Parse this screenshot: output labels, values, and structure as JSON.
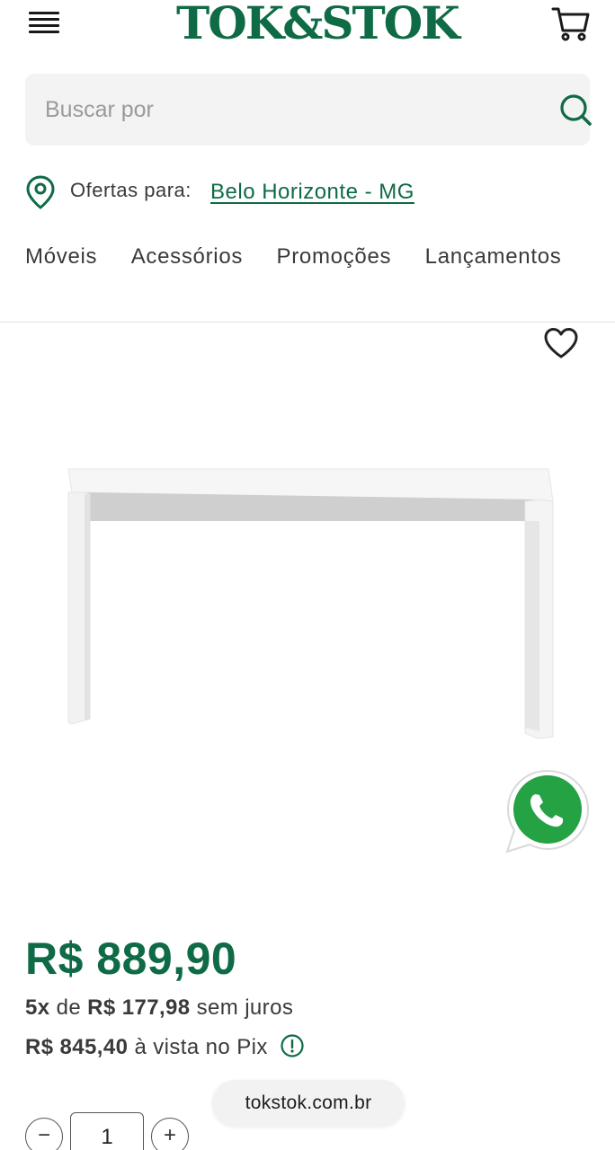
{
  "header": {
    "logo_text": "TOK&STOK",
    "menu_icon": "hamburger-menu-icon",
    "cart_icon": "shopping-cart-icon"
  },
  "search": {
    "placeholder": "Buscar por",
    "icon": "search-icon"
  },
  "location": {
    "prefix": "Ofertas para:",
    "city": "Belo Horizonte - MG",
    "icon": "map-pin-icon"
  },
  "nav": {
    "items": [
      "Móveis",
      "Acessórios",
      "Promoções",
      "Lançamentos"
    ]
  },
  "product": {
    "image_alt": "white-console-table",
    "favorite_icon": "heart-icon",
    "price": "R$ 889,90",
    "installments": {
      "count": "5x",
      "de": "de",
      "amount": "R$ 177,98",
      "suffix": "sem juros"
    },
    "pix": {
      "amount": "R$ 845,40",
      "suffix": "à vista no Pix",
      "icon": "info-icon"
    },
    "quantity": {
      "minus_label": "−",
      "value": "1",
      "plus_label": "+"
    }
  },
  "whatsapp_icon": "whatsapp-icon",
  "browser": {
    "url": "tokstok.com.br"
  },
  "colors": {
    "brand_green": "#0e6b45",
    "whatsapp_green": "#25a244",
    "search_bg": "#f3f3f3"
  }
}
